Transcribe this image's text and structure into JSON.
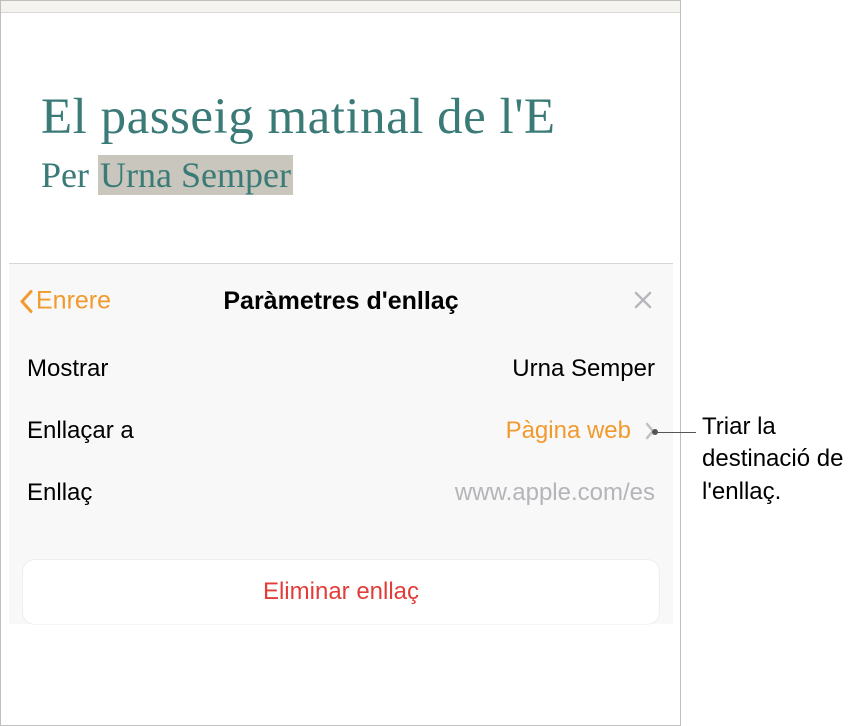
{
  "document": {
    "title": "El passeig matinal de l'E",
    "byline_prefix": "Per ",
    "byline_selected": "Urna Semper"
  },
  "popover": {
    "back_label": "Enrere",
    "title": "Paràmetres d'enllaç",
    "rows": {
      "display": {
        "label": "Mostrar",
        "value": "Urna Semper"
      },
      "link_to": {
        "label": "Enllaçar a",
        "value": "Pàgina web"
      },
      "link": {
        "label": "Enllaç",
        "value": "www.apple.com/es"
      }
    },
    "remove_label": "Eliminar enllaç"
  },
  "callout": {
    "text": "Triar la destinació de l'enllaç."
  }
}
